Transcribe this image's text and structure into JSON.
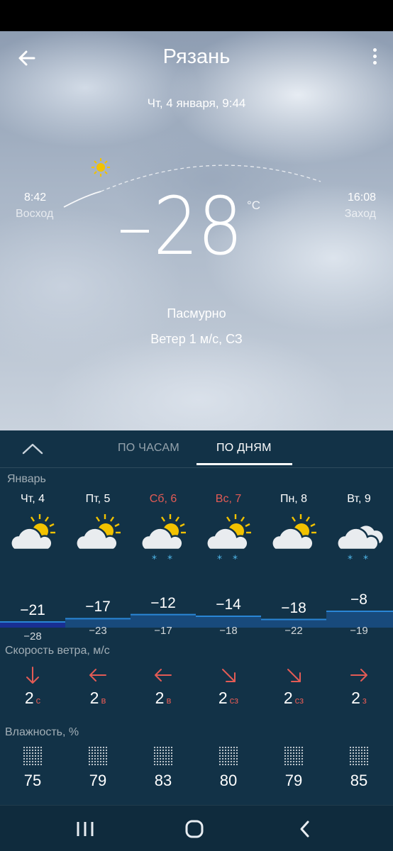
{
  "header": {
    "city": "Рязань",
    "datetime": "Чт, 4 января, 9:44"
  },
  "sun": {
    "sunrise_time": "8:42",
    "sunrise_label": "Восход",
    "sunset_time": "16:08",
    "sunset_label": "Заход"
  },
  "current": {
    "temperature": "28",
    "temperature_value": -28,
    "unit": "°C",
    "condition": "Пасмурно",
    "wind": "Ветер 1 м/с, СЗ"
  },
  "tabs": {
    "hourly": "ПО ЧАСАМ",
    "daily": "ПО ДНЯМ",
    "active": "daily"
  },
  "forecast": {
    "month": "Январь",
    "days": [
      {
        "label": "Чт, 4",
        "weekend": false,
        "icon": "partly-cloudy-icon",
        "high": "−21",
        "low": "−28",
        "wind_speed": "2",
        "wind_dir": "с",
        "humidity": "75"
      },
      {
        "label": "Пт, 5",
        "weekend": false,
        "icon": "partly-cloudy-icon",
        "high": "−17",
        "low": "−23",
        "wind_speed": "2",
        "wind_dir": "в",
        "humidity": "79"
      },
      {
        "label": "Сб, 6",
        "weekend": true,
        "icon": "partly-cloudy-snow-icon",
        "high": "−12",
        "low": "−17",
        "wind_speed": "2",
        "wind_dir": "в",
        "humidity": "83"
      },
      {
        "label": "Вс, 7",
        "weekend": true,
        "icon": "partly-cloudy-snow-icon",
        "high": "−14",
        "low": "−18",
        "wind_speed": "2",
        "wind_dir": "сз",
        "humidity": "80"
      },
      {
        "label": "Пн, 8",
        "weekend": false,
        "icon": "partly-cloudy-icon",
        "high": "−18",
        "low": "−22",
        "wind_speed": "2",
        "wind_dir": "сз",
        "humidity": "79"
      },
      {
        "label": "Вт, 9",
        "weekend": false,
        "icon": "cloudy-snow-icon",
        "high": "−8",
        "low": "−19",
        "wind_speed": "2",
        "wind_dir": "з",
        "humidity": "85"
      }
    ],
    "wind_label": "Скорость ветра, м/с",
    "humidity_label": "Влажность, %"
  },
  "colors": {
    "panel": "#123247",
    "weekend": "#e35b55",
    "accent_bar": "#1e6db0",
    "sun": "#f2c200"
  }
}
